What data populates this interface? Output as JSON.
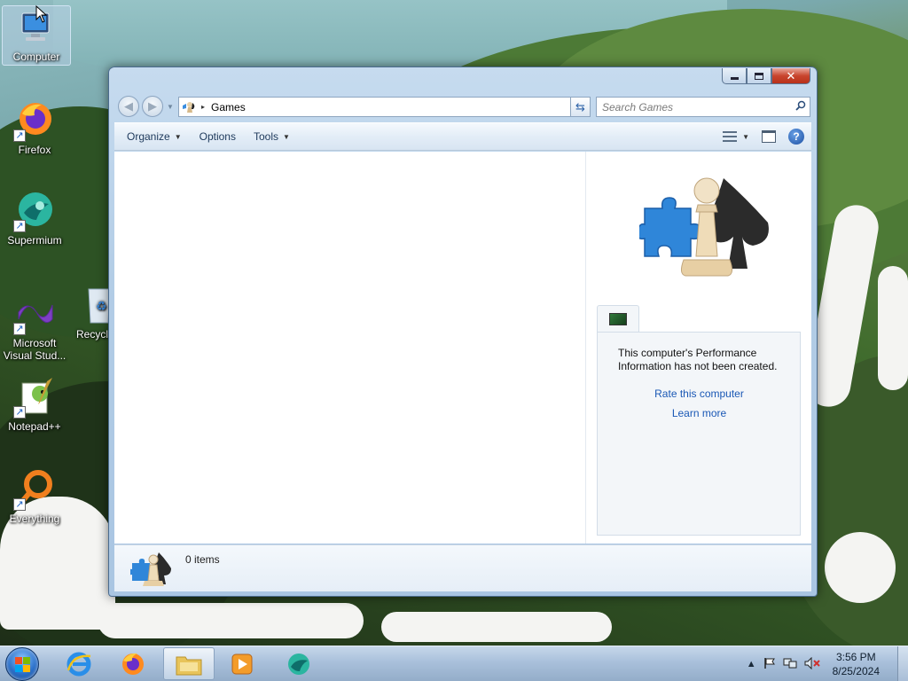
{
  "desktop": {
    "icons": [
      {
        "label": "Computer",
        "icon": "computer-icon"
      },
      {
        "label": "Firefox",
        "icon": "firefox-icon"
      },
      {
        "label": "Supermium",
        "icon": "supermium-icon"
      },
      {
        "label": "Microsoft Visual Stud...",
        "icon": "visual-studio-icon"
      },
      {
        "label": "Recycl",
        "icon": "recycle-bin-icon"
      },
      {
        "label": "Notepad++",
        "icon": "notepad-plus-plus-icon"
      },
      {
        "label": "Everything",
        "icon": "everything-search-icon"
      }
    ]
  },
  "window": {
    "title": "Games",
    "controls": {
      "minimize": "minimize-icon",
      "maximize": "maximize-icon",
      "close": "close-icon"
    },
    "address": {
      "separator": "▸",
      "location": "Games"
    },
    "search": {
      "placeholder": "Search Games"
    },
    "toolbar": {
      "organize": "Organize",
      "options": "Options",
      "tools": "Tools"
    },
    "preview": {
      "performance_message": "This computer's Performance Information has not been created.",
      "rate_link": "Rate this computer",
      "learn_link": "Learn more"
    },
    "details": {
      "item_count": "0 items"
    }
  },
  "taskbar": {
    "apps": [
      {
        "name": "internet-explorer",
        "icon": "internet-explorer-icon"
      },
      {
        "name": "firefox",
        "icon": "firefox-icon"
      },
      {
        "name": "windows-explorer",
        "icon": "folder-icon",
        "active": true
      },
      {
        "name": "windows-media-player",
        "icon": "media-player-icon"
      },
      {
        "name": "supermium",
        "icon": "supermium-icon"
      }
    ],
    "clock": {
      "time": "3:56 PM",
      "date": "8/25/2024"
    }
  },
  "colors": {
    "link": "#1a58b5",
    "window_frame": "#b3cde6",
    "close_button": "#c9452e"
  }
}
